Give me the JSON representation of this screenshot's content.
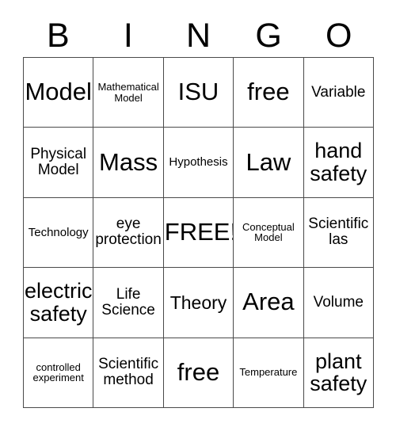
{
  "card": {
    "header_letters": [
      "B",
      "I",
      "N",
      "G",
      "O"
    ],
    "rows": [
      [
        {
          "text": "Model",
          "size": "xxl"
        },
        {
          "text": "Mathematical Model",
          "size": "xs"
        },
        {
          "text": "ISU",
          "size": "xxl"
        },
        {
          "text": "free",
          "size": "xxl"
        },
        {
          "text": "Variable",
          "size": "md"
        }
      ],
      [
        {
          "text": "Physical Model",
          "size": "md"
        },
        {
          "text": "Mass",
          "size": "xxl"
        },
        {
          "text": "Hypothesis",
          "size": "sm"
        },
        {
          "text": "Law",
          "size": "xxl"
        },
        {
          "text": "hand safety",
          "size": "xl"
        }
      ],
      [
        {
          "text": "Technology",
          "size": "sm"
        },
        {
          "text": "eye protection",
          "size": "md"
        },
        {
          "text": "FREE!",
          "size": "xxl"
        },
        {
          "text": "Conceptual Model",
          "size": "xs"
        },
        {
          "text": "Scientific las",
          "size": "md"
        }
      ],
      [
        {
          "text": "electric safety",
          "size": "xl"
        },
        {
          "text": "Life Science",
          "size": "md"
        },
        {
          "text": "Theory",
          "size": "lg"
        },
        {
          "text": "Area",
          "size": "xxl"
        },
        {
          "text": "Volume",
          "size": "md"
        }
      ],
      [
        {
          "text": "controlled experiment",
          "size": "xs"
        },
        {
          "text": "Scientific method",
          "size": "md"
        },
        {
          "text": "free",
          "size": "xxl"
        },
        {
          "text": "Temperature",
          "size": "xs"
        },
        {
          "text": "plant safety",
          "size": "xl"
        }
      ]
    ],
    "colors": {
      "border": "#4a4a4a",
      "text": "#000000",
      "background": "#ffffff"
    }
  }
}
